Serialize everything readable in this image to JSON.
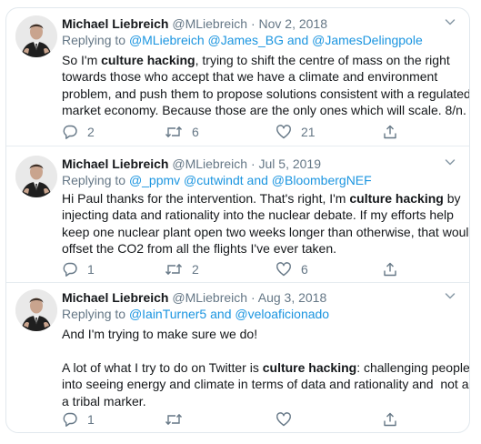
{
  "tweets": [
    {
      "name": "Michael Liebreich",
      "meta": "@MLiebreich · Nov 2, 2018",
      "reply_prefix": "Replying to",
      "reply_links": "@MLiebreich @James_BG",
      "reply_and": "and",
      "reply_last": "@JamesDelingpole",
      "lines": [
        {
          "pre": "So I'm ",
          "bold": "culture hacking",
          "post": ", trying to shift the centre of mass on the right"
        },
        {
          "pre": "towards those who accept that we have a climate and environment",
          "bold": "",
          "post": ""
        },
        {
          "pre": "problem, and push them to propose solutions consistent with a regulated",
          "bold": "",
          "post": ""
        },
        {
          "pre": "market economy. Because those are the only ones which will scale. 8/n.",
          "bold": "",
          "post": ""
        }
      ],
      "replies": "2",
      "retweets": "6",
      "likes": "21"
    },
    {
      "name": "Michael Liebreich",
      "meta": "@MLiebreich · Jul 5, 2019",
      "reply_prefix": "Replying to",
      "reply_links": "@_ppmv @cutwindt",
      "reply_and": "and",
      "reply_last": "@BloombergNEF",
      "lines": [
        {
          "pre": "Hi Paul thanks for the intervention. That's right, I'm ",
          "bold": "culture hacking",
          "post": " by"
        },
        {
          "pre": "injecting data and rationality into the nuclear debate. If my efforts help",
          "bold": "",
          "post": ""
        },
        {
          "pre": "keep one nuclear plant open two weeks longer than otherwise, that would",
          "bold": "",
          "post": ""
        },
        {
          "pre": "offset the CO2 from all the flights I've ever taken.",
          "bold": "",
          "post": ""
        }
      ],
      "replies": "1",
      "retweets": "2",
      "likes": "6"
    },
    {
      "name": "Michael Liebreich",
      "meta": "@MLiebreich · Aug 3, 2018",
      "reply_prefix": "Replying to",
      "reply_links": "@IainTurner5",
      "reply_and": "and",
      "reply_last": "@veloaficionado",
      "lines": [
        {
          "pre": "And I'm trying to make sure we do!",
          "bold": "",
          "post": ""
        },
        {
          "pre": "",
          "bold": "",
          "post": ""
        },
        {
          "pre": "A lot of what I try to do on Twitter is ",
          "bold": "culture hacking",
          "post": ": challenging people"
        },
        {
          "pre": "into seeing energy and climate in terms of data and rationality and  not as",
          "bold": "",
          "post": ""
        },
        {
          "pre": "a tribal marker.",
          "bold": "",
          "post": ""
        }
      ],
      "replies": "1",
      "retweets": "",
      "likes": ""
    }
  ],
  "icons": {
    "reply": "reply-icon",
    "retweet": "retweet-icon",
    "like": "heart-icon",
    "share": "share-icon",
    "more": "chevron-down-icon"
  },
  "colors": {
    "link": "#1b95e0",
    "muted": "#657786",
    "text": "#14171a"
  }
}
